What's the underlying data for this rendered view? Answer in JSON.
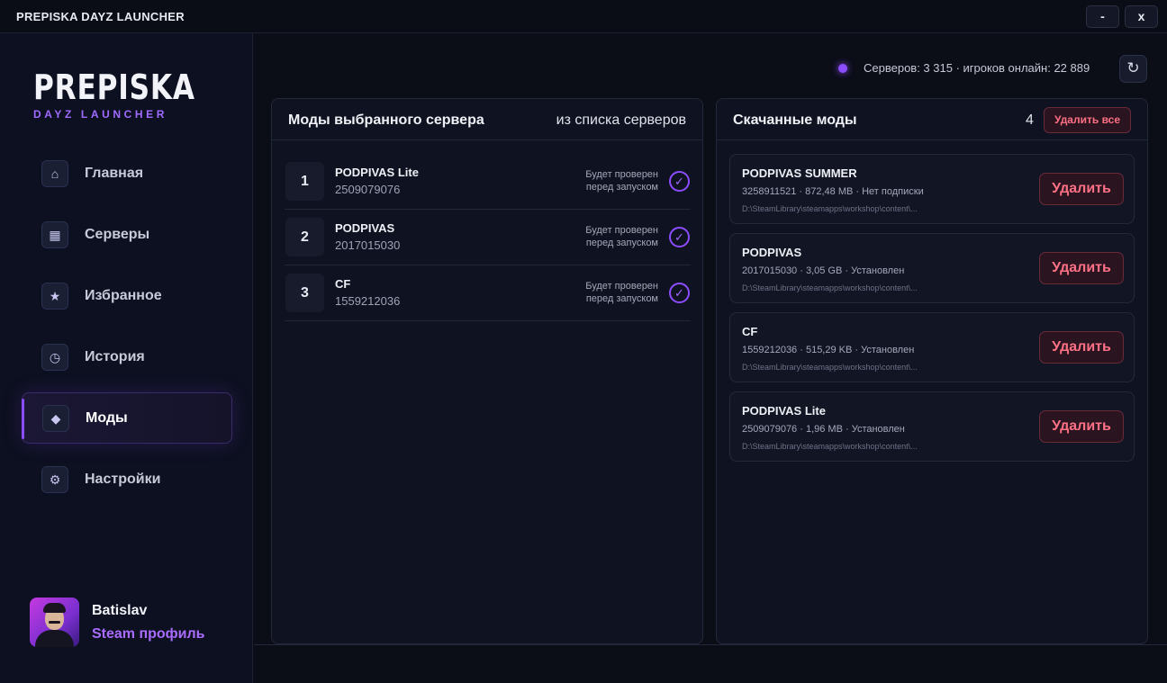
{
  "window": {
    "title": "PREPISKA DAYZ LAUNCHER",
    "minimize_label": "-",
    "close_label": "x"
  },
  "sidebar": {
    "logo_main": "PREPISKA",
    "logo_sub": "DAYZ LAUNCHER",
    "items": [
      {
        "label": "Главная",
        "icon": "home-icon",
        "glyph": "⌂"
      },
      {
        "label": "Серверы",
        "icon": "grid-icon",
        "glyph": "▦"
      },
      {
        "label": "Избранное",
        "icon": "star-icon",
        "glyph": "★"
      },
      {
        "label": "История",
        "icon": "clock-icon",
        "glyph": "◷"
      },
      {
        "label": "Моды",
        "icon": "diamond-icon",
        "glyph": "◆",
        "active": true
      },
      {
        "label": "Настройки",
        "icon": "gear-icon",
        "glyph": "⚙"
      }
    ],
    "profile": {
      "name": "Batislav",
      "link": "Steam профиль"
    }
  },
  "status": {
    "text": "Серверов: 3 315 · игроков онлайн: 22 889",
    "refresh_glyph": "↻",
    "dot_color": "#8c4dff"
  },
  "server_mods": {
    "title": "Моды выбранного сервера",
    "subtitle": "из списка серверов",
    "rows": [
      {
        "num": "1",
        "name": "PODPIVAS Lite",
        "id": "2509079076",
        "status_line1": "Будет проверен",
        "status_line2": "перед запуском",
        "check": "✓"
      },
      {
        "num": "2",
        "name": "PODPIVAS",
        "id": "2017015030",
        "status_line1": "Будет проверен",
        "status_line2": "перед запуском",
        "check": "✓"
      },
      {
        "num": "3",
        "name": "CF",
        "id": "1559212036",
        "status_line1": "Будет проверен",
        "status_line2": "перед запуском",
        "check": "✓"
      }
    ]
  },
  "downloaded_mods": {
    "title": "Скачанные моды",
    "count": "4",
    "delete_all_label": "Удалить все",
    "items": [
      {
        "name": "PODPIVAS SUMMER",
        "meta": "3258911521 · 872,48 MB · Нет подписки",
        "path": "D:\\SteamLibrary\\steamapps\\workshop\\content\\...",
        "button": "Удалить"
      },
      {
        "name": "PODPIVAS",
        "meta": "2017015030 · 3,05 GB · Установлен",
        "path": "D:\\SteamLibrary\\steamapps\\workshop\\content\\...",
        "button": "Удалить"
      },
      {
        "name": "CF",
        "meta": "1559212036 · 515,29 KB · Установлен",
        "path": "D:\\SteamLibrary\\steamapps\\workshop\\content\\...",
        "button": "Удалить"
      },
      {
        "name": "PODPIVAS Lite",
        "meta": "2509079076 · 1,96 MB · Установлен",
        "path": "D:\\SteamLibrary\\steamapps\\workshop\\content\\...",
        "button": "Удалить"
      }
    ]
  },
  "colors": {
    "accent": "#8c4dff",
    "danger": "#ff7184",
    "background": "#0b0d17"
  }
}
